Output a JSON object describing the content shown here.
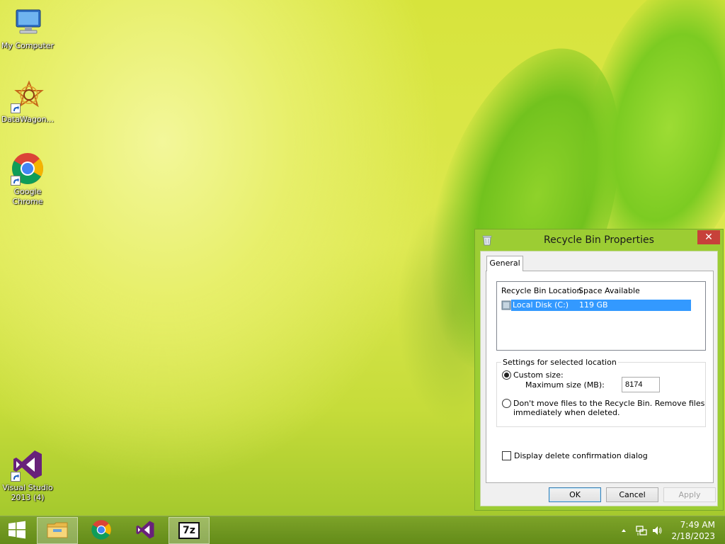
{
  "desktop": {
    "icons": [
      {
        "label": "My Computer",
        "icon": "computer-icon"
      },
      {
        "label": "DataWagon...",
        "icon": "datawagon-icon"
      },
      {
        "label": "Google Chrome",
        "label_line1": "Google",
        "label_line2": "Chrome",
        "icon": "chrome-icon"
      },
      {
        "label": "Visual Studio 2013 (4)",
        "label_line1": "Visual Studio",
        "label_line2": "2013 (4)",
        "icon": "visual-studio-icon"
      }
    ]
  },
  "taskbar": {
    "items": [
      {
        "name": "start",
        "icon": "windows-icon"
      },
      {
        "name": "file-explorer",
        "icon": "folder-icon"
      },
      {
        "name": "chrome",
        "icon": "chrome-icon"
      },
      {
        "name": "visual-studio",
        "icon": "visual-studio-icon"
      },
      {
        "name": "7zip",
        "icon": "7zip-icon",
        "label": "7z"
      }
    ],
    "clock": {
      "time": "7:49 AM",
      "date": "2/18/2023"
    }
  },
  "dialog": {
    "title": "Recycle Bin Properties",
    "close_glyph": "✕",
    "tab_label": "General",
    "list": {
      "col_location": "Recycle Bin Location",
      "col_space": "Space Available",
      "rows": [
        {
          "location": "Local Disk (C:)",
          "space": "119 GB"
        }
      ]
    },
    "settings": {
      "group_label": "Settings for selected location",
      "custom_size_label": "Custom size:",
      "max_size_label": "Maximum size (MB):",
      "max_size_value": "8174",
      "dont_move_line1": "Don't move files to the Recycle Bin. Remove files",
      "dont_move_line2": "immediately when deleted.",
      "confirm_label": "Display delete confirmation dialog"
    },
    "buttons": {
      "ok": "OK",
      "cancel": "Cancel",
      "apply": "Apply"
    }
  }
}
